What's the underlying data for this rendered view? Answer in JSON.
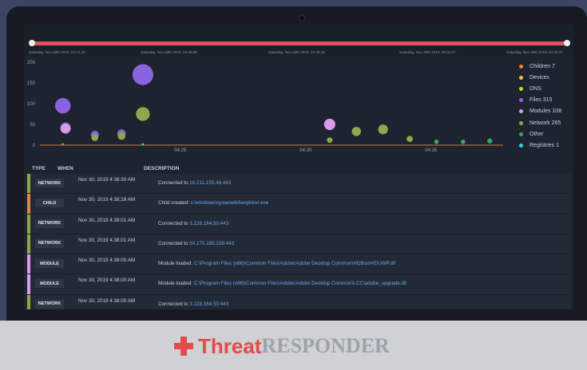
{
  "timeline": {
    "timestamps": [
      "Saturday, Nov 30th 2019, 04:21:33",
      "Saturday, Nov 30th 2019, 04:26:08",
      "Saturday, Nov 30th 2019, 04:30:18",
      "Saturday, Nov 30th 2019, 04:33:27",
      "Saturday, Nov 30th 2019, 04:36:37"
    ]
  },
  "chart_data": {
    "type": "scatter",
    "y_ticks": [
      "200",
      "150",
      "100",
      "50",
      "0"
    ],
    "x_ticks": [
      "04:25",
      "04:30",
      "04:35"
    ],
    "ylim": [
      0,
      200
    ],
    "grid": false,
    "legend_position": "right",
    "series": [
      {
        "name": "Children 7",
        "color": "#e8833a",
        "points": [
          {
            "x": 0.0,
            "y": 2
          }
        ]
      },
      {
        "name": "Devices",
        "color": "#e8c53a",
        "points": []
      },
      {
        "name": "DNS",
        "color": "#c8d63a",
        "points": []
      },
      {
        "name": "Files 315",
        "color": "#8a63e0",
        "points": [
          {
            "x": 0.0,
            "y": 95
          },
          {
            "x": 3.0,
            "y": 170
          },
          {
            "x": 2.2,
            "y": 28
          },
          {
            "x": 1.2,
            "y": 25
          },
          {
            "x": 0.1,
            "y": 42
          }
        ]
      },
      {
        "name": "Modules 108",
        "color": "#d99ae8",
        "points": [
          {
            "x": 10.0,
            "y": 50
          },
          {
            "x": 0.1,
            "y": 40
          }
        ]
      },
      {
        "name": "Network 265",
        "color": "#8ea84b",
        "points": [
          {
            "x": 3.0,
            "y": 75
          },
          {
            "x": 11.0,
            "y": 33
          },
          {
            "x": 12.0,
            "y": 38
          },
          {
            "x": 13.0,
            "y": 15
          },
          {
            "x": 10.0,
            "y": 12
          },
          {
            "x": 2.2,
            "y": 22
          },
          {
            "x": 1.2,
            "y": 18
          }
        ]
      },
      {
        "name": "Other",
        "color": "#3ba55c",
        "points": [
          {
            "x": 14.0,
            "y": 8
          },
          {
            "x": 15.0,
            "y": 8
          },
          {
            "x": 16.0,
            "y": 10
          }
        ]
      },
      {
        "name": "Registries 1",
        "color": "#3ad0e0",
        "points": [
          {
            "x": 3.0,
            "y": 2
          }
        ]
      }
    ]
  },
  "table": {
    "headers": {
      "type": "TYPE",
      "when": "WHEN",
      "description": "DESCRIPTION"
    },
    "rows": [
      {
        "type": "NETWORK",
        "color": "#8ea84b",
        "when": "Nov 30, 2019 4:38:30 AM",
        "prefix": "Connected to ",
        "target": "18.211.155.46:443"
      },
      {
        "type": "CHILD",
        "color": "#e8833a",
        "when": "Nov 30, 2019 4:38:18 AM",
        "prefix": "Child created: ",
        "target": "c:\\windows\\syswow64\\explorer.exe"
      },
      {
        "type": "NETWORK",
        "color": "#8ea84b",
        "when": "Nov 30, 2019 4:38:01 AM",
        "prefix": "Connected to ",
        "target": "3.228.164.50:443"
      },
      {
        "type": "NETWORK",
        "color": "#8ea84b",
        "when": "Nov 30, 2019 4:38:01 AM",
        "prefix": "Connected to ",
        "target": "54.175.195.239:443"
      },
      {
        "type": "MODULE",
        "color": "#d99ae8",
        "when": "Nov 30, 2019 4:38:00 AM",
        "prefix": "Module loaded: ",
        "target": "C:\\Program Files (x86)\\Common Files\\Adobe\\Adobe Desktop Common\\HDBox\\HDUWP.dll"
      },
      {
        "type": "MODULE",
        "color": "#d99ae8",
        "when": "Nov 30, 2019 4:38:00 AM",
        "prefix": "Module loaded: ",
        "target": "C:\\Program Files (x86)\\Common Files\\Adobe\\Adobe Desktop Common\\LCC\\adobe_upgrade.dll"
      },
      {
        "type": "NETWORK",
        "color": "#8ea84b",
        "when": "Nov 30, 2019 4:38:00 AM",
        "prefix": "Connected to ",
        "target": "3.228.164.50:443"
      }
    ]
  },
  "brand": {
    "part1": "Threat",
    "part2": "RESPONDER"
  }
}
